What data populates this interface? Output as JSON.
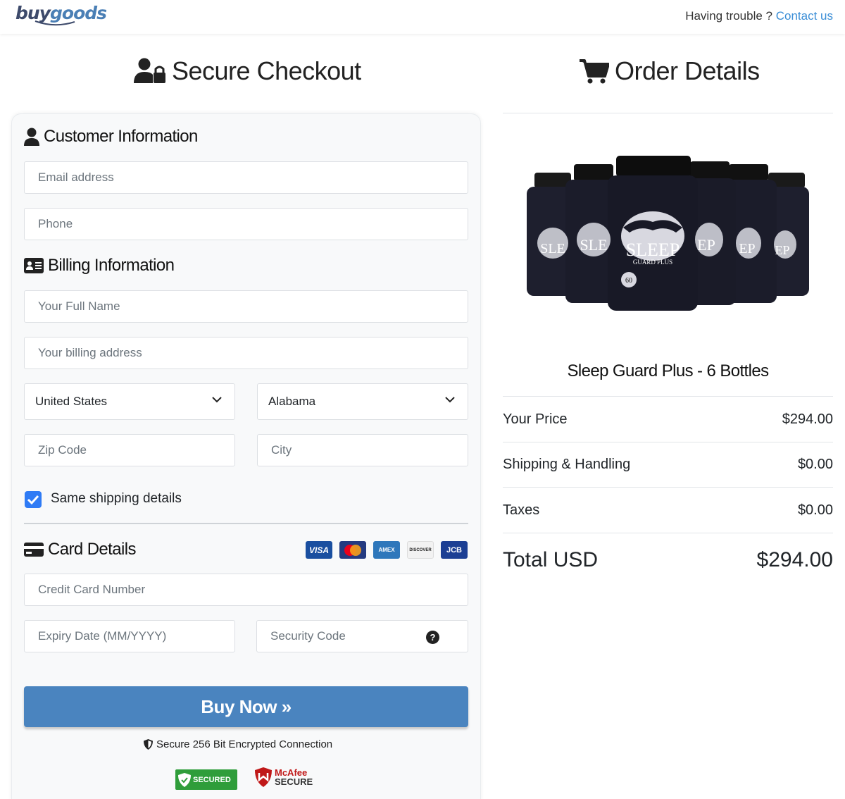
{
  "header": {
    "logo_part1": "buy",
    "logo_part2": "goods",
    "trouble_text": "Having trouble ? ",
    "contact_link": "Contact us"
  },
  "checkout": {
    "title": "Secure Checkout",
    "customer": {
      "heading": "Customer Information",
      "email_placeholder": "Email address",
      "phone_placeholder": "Phone"
    },
    "billing": {
      "heading": "Billing Information",
      "name_placeholder": "Your Full Name",
      "address_placeholder": "Your billing address",
      "country_value": "United States",
      "state_value": "Alabama",
      "zip_placeholder": "Zip Code",
      "city_placeholder": "City",
      "same_shipping_label": "Same shipping details",
      "same_shipping_checked": true
    },
    "card": {
      "heading": "Card Details",
      "brands": [
        "VISA",
        "mastercard",
        "AMEX",
        "DISCOVER",
        "JCB"
      ],
      "number_placeholder": "Credit Card Number",
      "expiry_placeholder": "Expiry Date (MM/YYYY)",
      "cvv_placeholder": "Security Code"
    },
    "buy_button": "Buy Now »",
    "secure_note": "Secure 256 Bit Encrypted Connection",
    "badges": {
      "trustguard": "SECURED",
      "mcafee_line1": "McAfee",
      "mcafee_line2": "SECURE"
    }
  },
  "order": {
    "title": "Order Details",
    "product_name": "Sleep Guard Plus - 6 Bottles",
    "rows": [
      {
        "label": "Your Price",
        "value": "$294.00"
      },
      {
        "label": "Shipping & Handling",
        "value": "$0.00"
      },
      {
        "label": "Taxes",
        "value": "$0.00"
      }
    ],
    "total_label": "Total USD",
    "total_value": "$294.00"
  },
  "colors": {
    "accent_button": "#4a84bf",
    "link": "#3b8ed6",
    "checkbox": "#2f7bf5"
  }
}
